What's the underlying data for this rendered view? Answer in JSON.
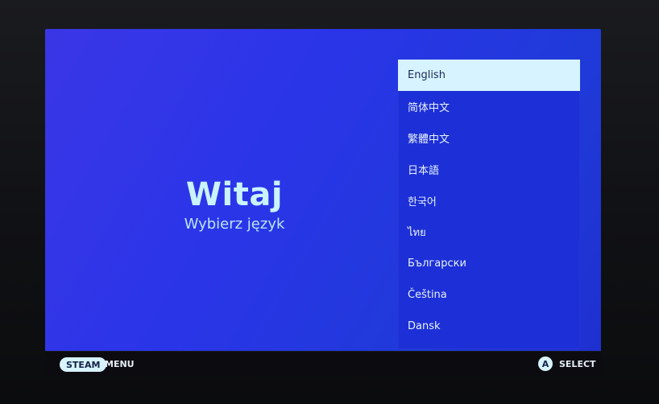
{
  "welcome": {
    "title": "Witaj",
    "subtitle": "Wybierz język"
  },
  "languages": [
    {
      "label": "English",
      "selected": true
    },
    {
      "label": "简体中文",
      "selected": false
    },
    {
      "label": "繁體中文",
      "selected": false
    },
    {
      "label": "日本語",
      "selected": false
    },
    {
      "label": "한국어",
      "selected": false
    },
    {
      "label": "ไทย",
      "selected": false
    },
    {
      "label": "Български",
      "selected": false
    },
    {
      "label": "Čeština",
      "selected": false
    },
    {
      "label": "Dansk",
      "selected": false
    }
  ],
  "footer": {
    "steam_label": "STEAM",
    "menu_label": "MENU",
    "a_button_label": "A",
    "select_label": "SELECT"
  },
  "colors": {
    "screen_bg": "#2a35e8",
    "panel_bg": "#1d2fd6",
    "selected_bg": "#d7f3ff",
    "accent_text": "#c9f3ff"
  }
}
